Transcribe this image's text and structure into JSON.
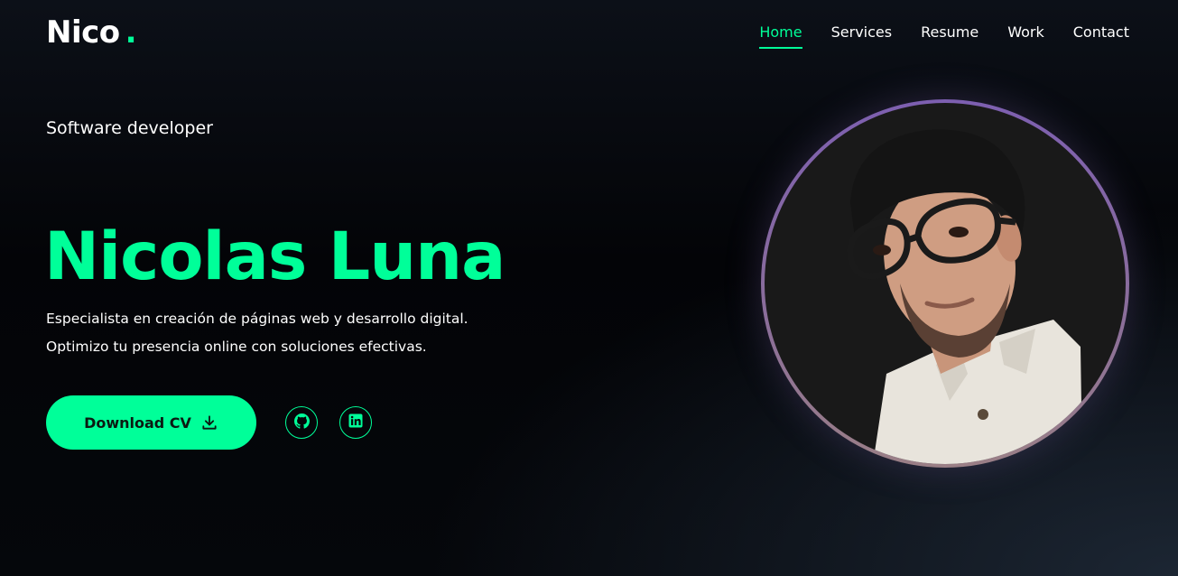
{
  "header": {
    "logo": "Nico",
    "logo_dot": ".",
    "nav": [
      "Home",
      "Services",
      "Resume",
      "Work",
      "Contact"
    ],
    "active_nav": "Home"
  },
  "hero": {
    "subtitle": "Software developer",
    "name": "Nicolas Luna",
    "description_line1": "Especialista en creación de páginas web y desarrollo digital.",
    "description_line2": "Optimizo tu presencia online con soluciones efectivas.",
    "cv_button_label": "Download CV",
    "cv_button_icon": "download-icon",
    "social_icons": [
      "github-icon",
      "linkedin-icon"
    ]
  },
  "colors": {
    "accent": "#00ff99",
    "background": "#05070b",
    "avatar_ring": "#7d5fb0"
  }
}
